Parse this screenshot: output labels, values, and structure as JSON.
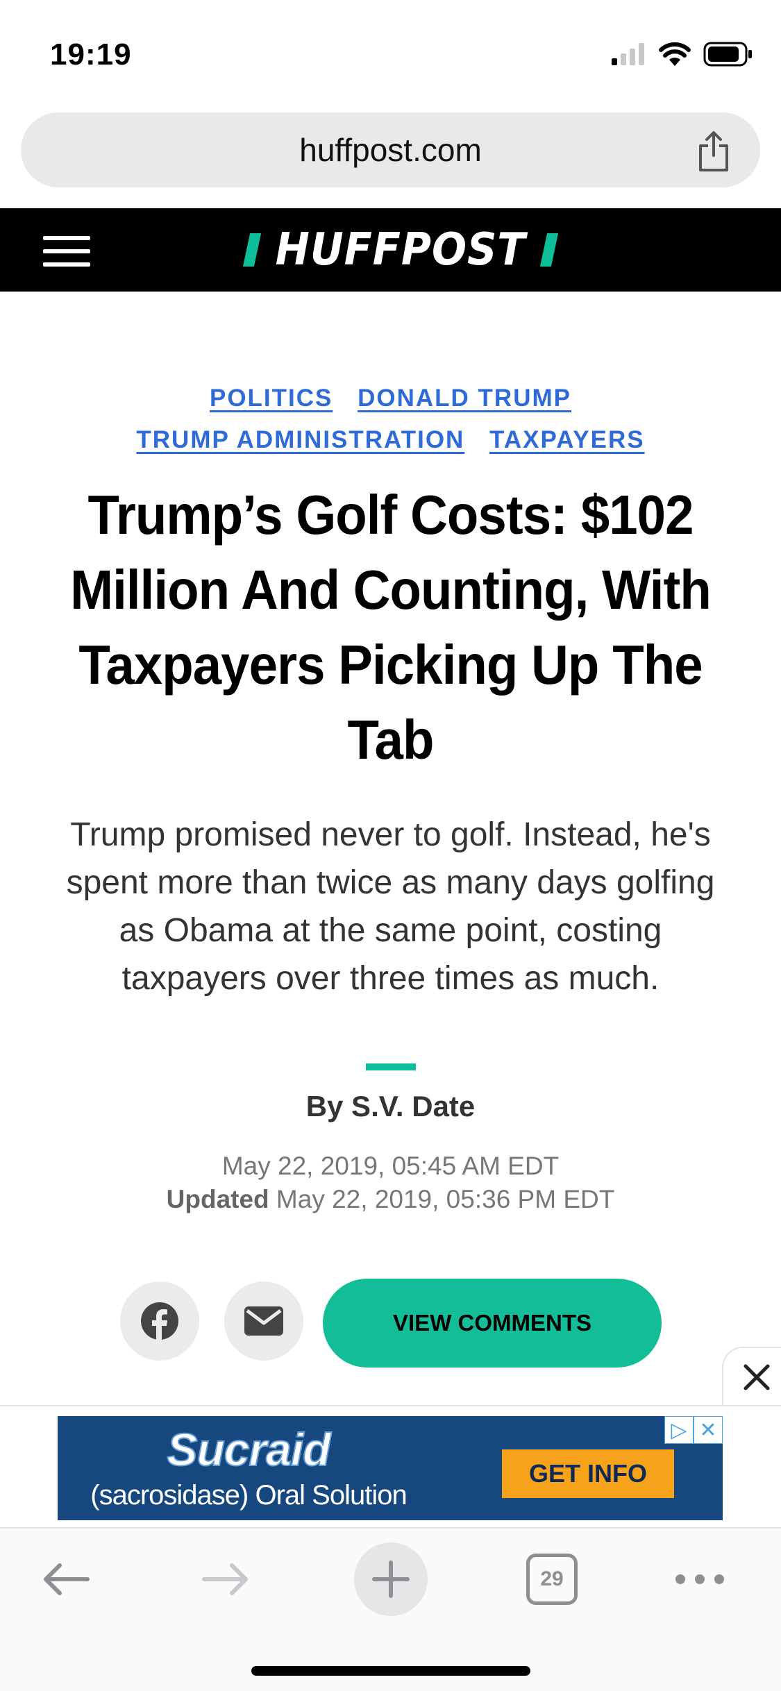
{
  "status_bar": {
    "time": "19:19"
  },
  "browser": {
    "url": "huffpost.com",
    "tab_count": "29"
  },
  "header": {
    "logo_text": "HUFFPOST"
  },
  "article": {
    "tags": [
      "POLITICS",
      "DONALD TRUMP",
      "TRUMP ADMINISTRATION",
      "TAXPAYERS"
    ],
    "headline": "Trump’s Golf Costs: $102 Million And Counting, With Taxpayers Picking Up The Tab",
    "dek": "Trump promised never to golf. Instead, he's spent more than twice as many days golfing as Obama at the same point, costing taxpayers over three times as much.",
    "byline": "By S.V. Date",
    "published": "May 22, 2019, 05:45 AM EDT",
    "updated_label": "Updated",
    "updated": "May 22, 2019, 05:36 PM EDT",
    "view_comments_label": "VIEW COMMENTS"
  },
  "ad": {
    "brand": "Sucraid",
    "subtitle": "(sacrosidase) Oral Solution",
    "cta": "GET INFO",
    "brand_color": "#16487f",
    "cta_color": "#f7a21b"
  },
  "icons": [
    "signal-icon",
    "wifi-icon",
    "battery-icon",
    "share-icon",
    "menu-icon",
    "facebook-icon",
    "mail-icon",
    "close-icon",
    "back-icon",
    "forward-icon",
    "plus-icon",
    "tabs-icon",
    "more-icon"
  ],
  "colors": {
    "accent": "#0dbe98",
    "tag_link": "#2e6bd8",
    "header_bg": "#000000"
  }
}
